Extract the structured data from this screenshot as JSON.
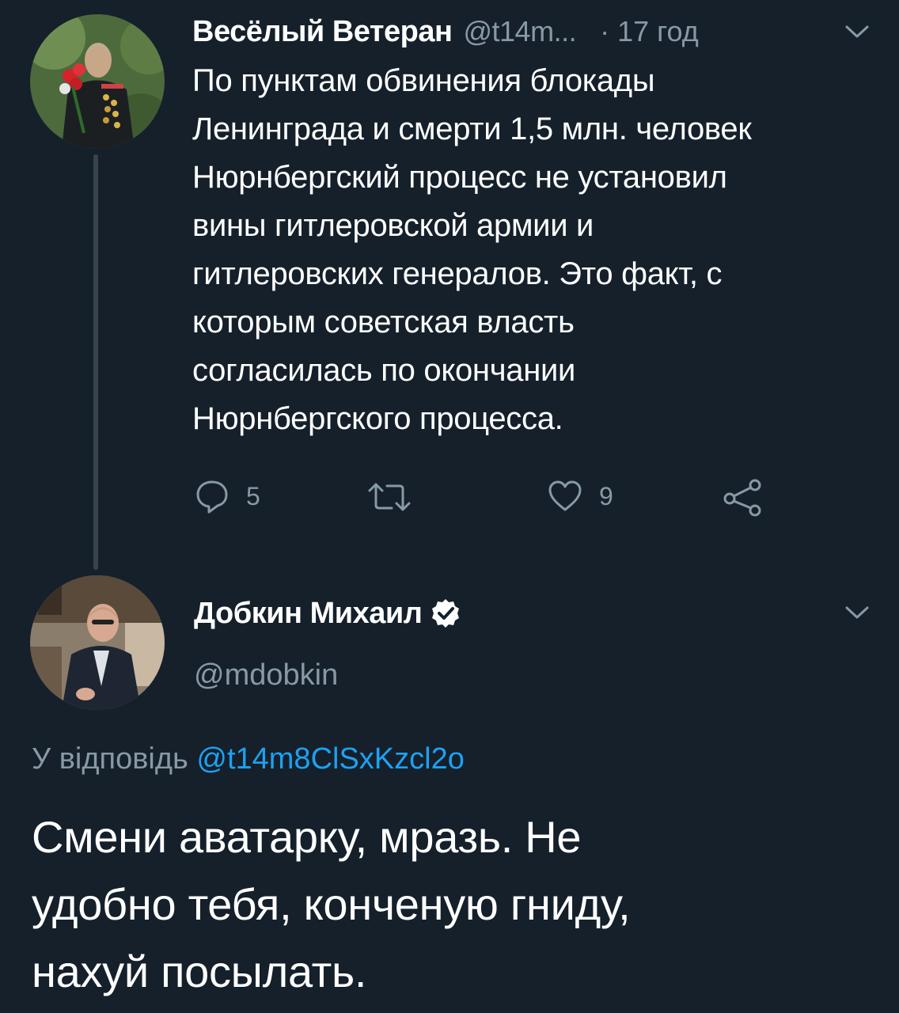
{
  "tweet": {
    "author_name": "Весёлый Ветеран",
    "author_handle": "@t14m...",
    "separator": "·",
    "time": "17 год",
    "text_lines": [
      "По пунктам обвинения блокады",
      "Ленинграда и смерти 1,5 млн. человек",
      "Нюрнбергский процесс не установил",
      "вины гитлеровской армии и",
      "гитлеровских генералов. Это факт, с",
      "которым советская власть",
      "согласилась по окончании",
      "Нюрнбергского процесса."
    ],
    "reply_count": "5",
    "like_count": "9"
  },
  "reply": {
    "author_name": "Добкин Михаил",
    "author_handle": "@mdobkin",
    "replying_to_prefix": "У відповідь",
    "replying_to_handle": "@t14m8ClSxKzcl2o",
    "text_lines": [
      "Смени аватарку, мразь. Не",
      "удобно тебя, конченую гниду,",
      "нахуй посылать."
    ]
  },
  "icons": {
    "reply": "reply-icon",
    "retweet": "retweet-icon",
    "like": "heart-icon",
    "share": "share-icon",
    "menu": "chevron-down-icon",
    "verified": "verified-badge-icon"
  },
  "colors": {
    "background": "#15202b",
    "secondary_text": "#8899a6",
    "link": "#1da1f2",
    "thread_line": "#38444d"
  }
}
